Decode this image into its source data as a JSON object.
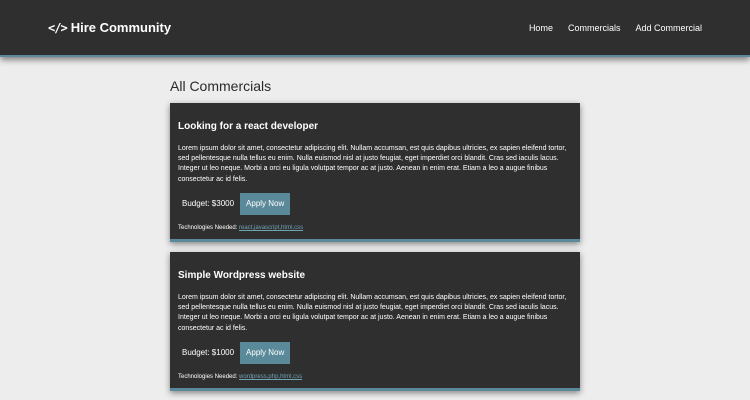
{
  "nav": {
    "brand_icon": "</>",
    "brand": "Hire Community",
    "links": [
      "Home",
      "Commercials",
      "Add Commercial"
    ]
  },
  "page": {
    "title": "All Commercials"
  },
  "cards": [
    {
      "title": "Looking for a react developer",
      "description": "Lorem ipsum dolor sit amet, consectetur adipiscing elit. Nullam accumsan, est quis dapibus ultricies, ex sapien eleifend tortor, sed pellentesque nulla tellus eu enim. Nulla euismod nisl at justo feugiat, eget imperdiet orci blandit. Cras sed iaculis lacus. Integer ut leo neque. Morbi a orci eu ligula volutpat tempor ac at justo. Aenean in enim erat. Etiam a leo a augue finibus consectetur ac id felis.",
      "budget": "Budget: $3000",
      "apply_label": "Apply Now",
      "tech_label": "Technologies Needed: ",
      "tech": "react,javascript,html,css"
    },
    {
      "title": "Simple Wordpress website",
      "description": "Lorem ipsum dolor sit amet, consectetur adipiscing elit. Nullam accumsan, est quis dapibus ultricies, ex sapien eleifend tortor, sed pellentesque nulla tellus eu enim. Nulla euismod nisl at justo feugiat, eget imperdiet orci blandit. Cras sed iaculis lacus. Integer ut leo neque. Morbi a orci eu ligula volutpat tempor ac at justo. Aenean in enim erat. Etiam a leo a augue finibus consectetur ac id felis.",
      "budget": "Budget: $1000",
      "apply_label": "Apply Now",
      "tech_label": "Technologies Needed: ",
      "tech": "wordpress,php,html,css"
    }
  ],
  "colors": {
    "navbar": "#2f2f2f",
    "accent": "#5a8a9a",
    "card": "#2f2f2f",
    "page_bg": "#ededed"
  }
}
